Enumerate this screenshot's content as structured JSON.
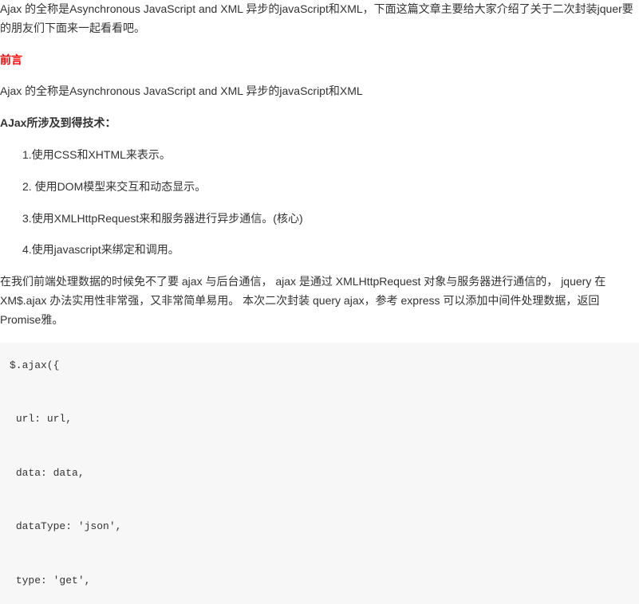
{
  "intro": "Ajax 的全称是Asynchronous JavaScript and XML 异步的javaScript和XML，下面这篇文章主要给大家介绍了关于二次封装jquer要的朋友们下面来一起看看吧。",
  "section_title": "前言",
  "ajax_def": "Ajax 的全称是Asynchronous JavaScript and XML 异步的javaScript和XML",
  "tech_heading": "AJax所涉及到得技术：",
  "tech_list": {
    "item1": "1.使用CSS和XHTML来表示。",
    "item2": "2. 使用DOM模型来交互和动态显示。",
    "item3": "3.使用XMLHttpRequest来和服务器进行异步通信。(核心)",
    "item4": "4.使用javascript来绑定和调用。"
  },
  "body_para": "在我们前端处理数据的时候免不了要 ajax 与后台通信， ajax 是通过 XMLHttpRequest 对象与服务器进行通信的， jquery 在 XM$.ajax 办法实用性非常强，又非常简单易用。 本次二次封装 query ajax，参考 express 可以添加中间件处理数据，返回 Promise雅。",
  "code": {
    "line1": "$.ajax({",
    "line2": " url: url,",
    "line3": " data: data,",
    "line4": " dataType: 'json',",
    "line5": " type: 'get',"
  }
}
